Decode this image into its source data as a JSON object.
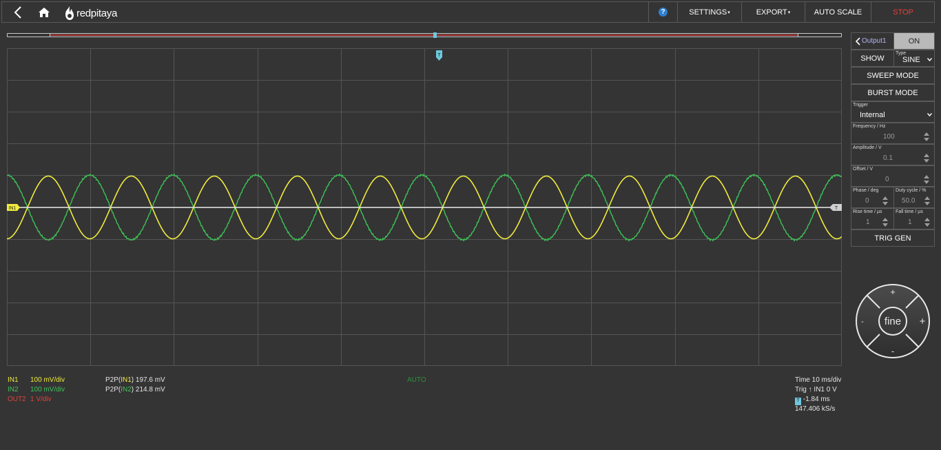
{
  "topbar": {
    "logo_text": "redpitaya",
    "help_label": "?",
    "settings_label": "SETTINGS",
    "export_label": "EXPORT",
    "autoscale_label": "AUTO SCALE",
    "stop_label": "STOP",
    "caret": "▾"
  },
  "timeline": {
    "marker_position": 0.51
  },
  "plot": {
    "trigger_marker": "T",
    "in1_marker": "IN1",
    "trig_level_marker": "T",
    "colors": {
      "in1": "#f1ec3d",
      "in2": "#3ec457",
      "grid": "#555555",
      "level": "#e6e6e6"
    },
    "grid_divisions": {
      "x": 10,
      "y": 10
    }
  },
  "channels": [
    {
      "name": "IN1",
      "scale": "100 mV/div",
      "color": "#f1ec3d"
    },
    {
      "name": "IN2",
      "scale": "100 mV/div",
      "color": "#3ec457"
    },
    {
      "name": "OUT2",
      "scale": "1 V/div",
      "color": "#e5403a"
    }
  ],
  "measurements": [
    {
      "prefix": "P2P(",
      "ch": "IN1",
      "suffix": ") 197.6 mV"
    },
    {
      "prefix": "P2P(",
      "ch": "IN2",
      "suffix": ") 214.8 mV"
    }
  ],
  "mode_label": "AUTO",
  "timing": {
    "time": "Time 10 ms/div",
    "trig_prefix": "Trig",
    "trig_value": "IN1 0 V",
    "trig_glyph": "↑",
    "t_marker": "T",
    "offset": "-1.84 ms",
    "rate": "147.406 kS/s"
  },
  "panel": {
    "output_label": "Output1",
    "on_label": "ON",
    "show_label": "SHOW",
    "type_caption": "Type",
    "type_value": "SINE",
    "sweep_label": "SWEEP MODE",
    "burst_label": "BURST MODE",
    "trigger_caption": "Trigger",
    "trigger_value": "Internal",
    "frequency_caption": "Frequency / Hz",
    "frequency_value": "100",
    "amplitude_caption": "Amplitude / V",
    "amplitude_value": "0.1",
    "offset_caption": "Offset / V",
    "offset_value": "0",
    "phase_caption": "Phase / deg",
    "phase_value": "0",
    "duty_caption": "Duty cycle / %",
    "duty_value": "50.0",
    "rise_caption": "Rise time / µs",
    "rise_value": "1",
    "fall_caption": "Fall time / µs",
    "fall_value": "1",
    "trig_gen_label": "TRIG GEN"
  },
  "wheel": {
    "center_label": "fine",
    "plus": "+",
    "minus": "-"
  }
}
